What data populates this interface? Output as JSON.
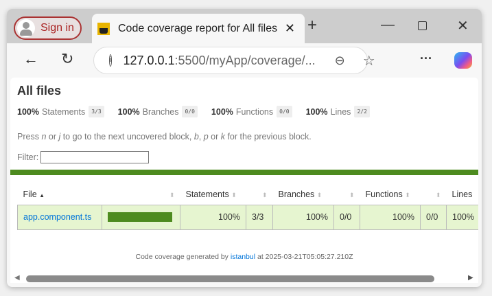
{
  "browser": {
    "sign_in": "Sign in",
    "tab_title": "Code coverage report for All files",
    "url_host": "127.0.0.1",
    "url_path": ":5500/myApp/coverage/...",
    "icons": [
      "profile-icon",
      "favicon",
      "close-icon",
      "new-tab-icon",
      "minimize-icon",
      "maximize-icon",
      "window-close-icon",
      "back-icon",
      "refresh-icon",
      "info-icon",
      "zoom-out-icon",
      "favorite-star-icon",
      "more-icon",
      "copilot-icon"
    ]
  },
  "report": {
    "title": "All files",
    "summary": [
      {
        "pct": "100%",
        "label": "Statements",
        "frac": "3/3"
      },
      {
        "pct": "100%",
        "label": "Branches",
        "frac": "0/0"
      },
      {
        "pct": "100%",
        "label": "Functions",
        "frac": "0/0"
      },
      {
        "pct": "100%",
        "label": "Lines",
        "frac": "2/2"
      }
    ],
    "hint": {
      "a": "Press ",
      "n": "n",
      "b": " or ",
      "j": "j",
      "c": " to go to the next uncovered block, ",
      "bk": "b",
      "d": ", ",
      "p": "p",
      "e": " or ",
      "k": "k",
      "f": " for the previous block."
    },
    "filter_label": "Filter:",
    "filter_value": "",
    "headers": {
      "file": "File",
      "statements": "Statements",
      "branches": "Branches",
      "functions": "Functions",
      "lines": "Lines"
    },
    "rows": [
      {
        "file": "app.component.ts",
        "coverage_percent": 100,
        "statements_pct": "100%",
        "statements": "3/3",
        "branches_pct": "100%",
        "branches": "0/0",
        "functions_pct": "100%",
        "functions": "0/0",
        "lines_pct": "100%"
      }
    ],
    "footer": {
      "prefix": "Code coverage generated by ",
      "link": "istanbul",
      "suffix": " at 2025-03-21T05:05:27.210Z"
    },
    "colors": {
      "high": "#4d8b1f",
      "row_bg": "#e6f5d0"
    }
  }
}
